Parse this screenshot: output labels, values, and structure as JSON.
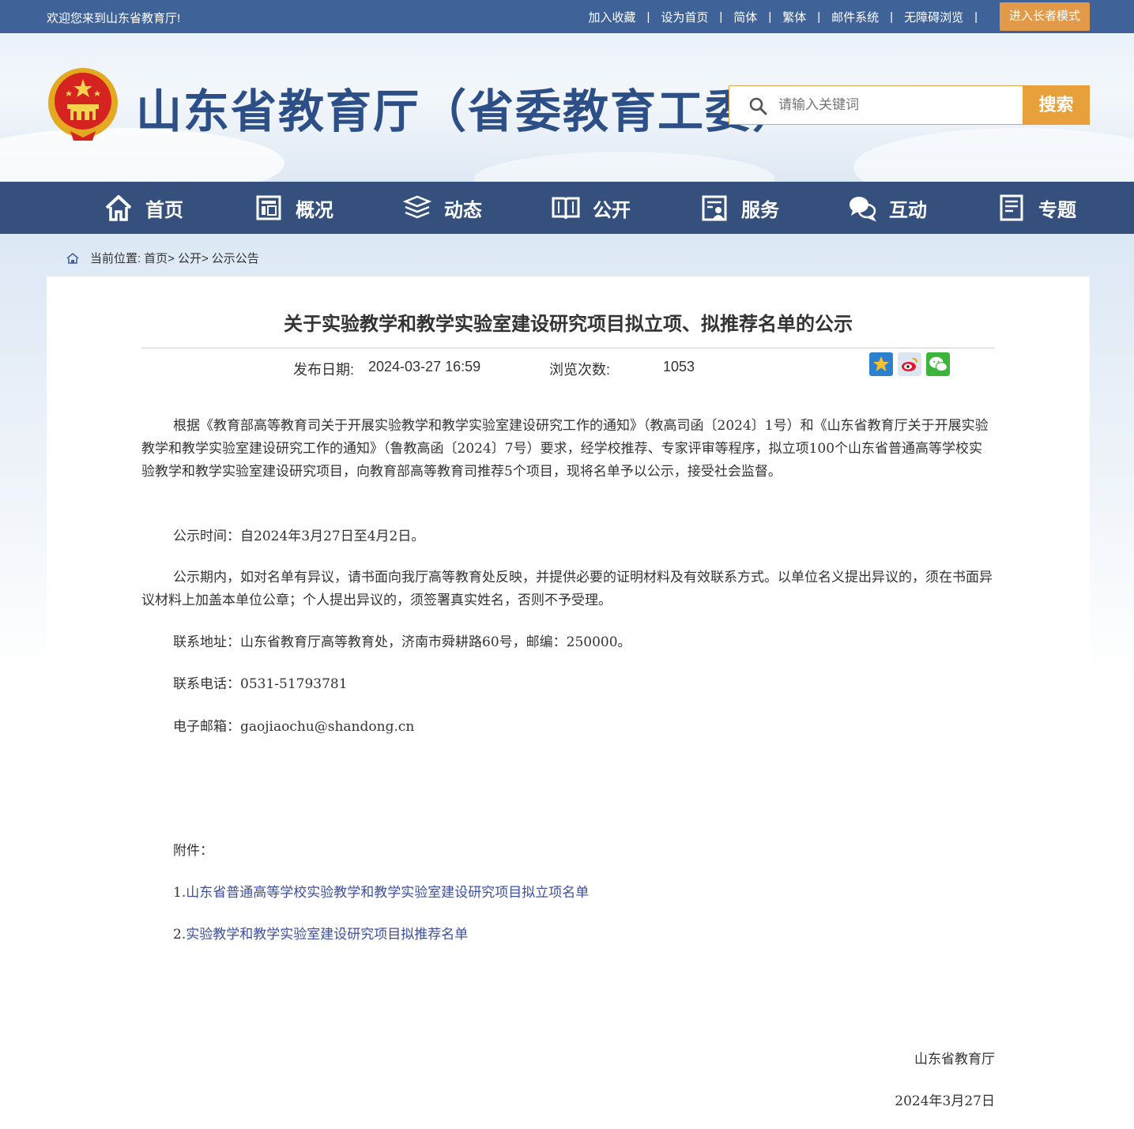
{
  "topbar": {
    "welcome": "欢迎您来到山东省教育厅!",
    "links": [
      "加入收藏",
      "设为首页",
      "简体",
      "繁体",
      "邮件系统",
      "无障碍浏览"
    ],
    "elder_mode": "进入长者模式"
  },
  "header": {
    "site_title": "山东省教育厅（省委教育工委）",
    "search_placeholder": "请输入关键词",
    "search_button": "搜索"
  },
  "nav": [
    {
      "label": "首页",
      "icon": "home-icon"
    },
    {
      "label": "概况",
      "icon": "overview-icon"
    },
    {
      "label": "动态",
      "icon": "news-stack-icon"
    },
    {
      "label": "公开",
      "icon": "open-book-icon"
    },
    {
      "label": "服务",
      "icon": "service-icon"
    },
    {
      "label": "互动",
      "icon": "chat-icon"
    },
    {
      "label": "专题",
      "icon": "topic-icon"
    }
  ],
  "breadcrumb": {
    "prefix": "当前位置:",
    "items": [
      "首页>",
      "公开>",
      "公示公告"
    ]
  },
  "article": {
    "title": "关于实验教学和教学实验室建设研究项目拟立项、拟推荐名单的公示",
    "date_label": "发布日期:",
    "date_value": "2024-03-27 16:59",
    "views_label": "浏览次数:",
    "views_value": "1053",
    "paragraphs": [
      "根据《教育部高等教育司关于开展实验教学和教学实验室建设研究工作的通知》（教高司函〔2024〕1号）和《山东省教育厅关于开展实验教学和教学实验室建设研究工作的通知》（鲁教高函〔2024〕7号）要求，经学校推荐、专家评审等程序，拟立项100个山东省普通高等学校实验教学和教学实验室建设研究项目，向教育部高等教育司推荐5个项目，现将名单予以公示，接受社会监督。",
      "公示时间：自2024年3月27日至4月2日。",
      "公示期内，如对名单有异议，请书面向我厅高等教育处反映，并提供必要的证明材料及有效联系方式。以单位名义提出异议的，须在书面异议材料上加盖本单位公章；个人提出异议的，须签署真实姓名，否则不予受理。",
      "联系地址：山东省教育厅高等教育处，济南市舜耕路60号，邮编：250000。",
      "联系电话：0531-51793781",
      "电子邮箱：gaojiaochu@shandong.cn"
    ],
    "attachments_label": "附件：",
    "attachments": [
      {
        "num": "1.",
        "text": "山东省普通高等学校实验教学和教学实验室建设研究项目拟立项名单"
      },
      {
        "num": "2.",
        "text": "实验教学和教学实验室建设研究项目拟推荐名单"
      }
    ],
    "signature": "山东省教育厅",
    "sign_date": "2024年3月27日"
  },
  "colors": {
    "topbar": "#3f6399",
    "nav": "#35507d",
    "accent_orange": "#e8a03a",
    "title_blue": "#2d4f88",
    "link": "#3c4fa0"
  }
}
